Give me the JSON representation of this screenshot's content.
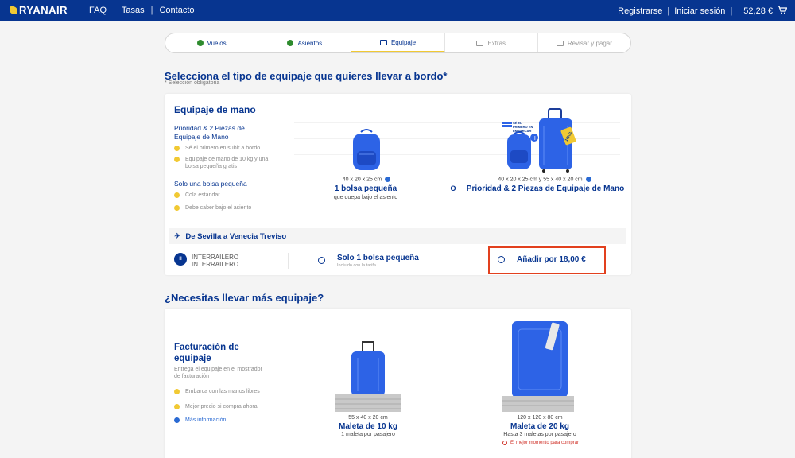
{
  "brand": {
    "logo_text": "RYANAIR",
    "accent": "#f1c933",
    "primary": "#073590",
    "highlight": "#e2401e"
  },
  "header": {
    "nav": [
      "FAQ",
      "Tasas",
      "Contacto"
    ],
    "register": "Registrarse",
    "login": "Iniciar sesión",
    "price": "52,28 €",
    "cart_icon": "cart-icon"
  },
  "steps": [
    {
      "label": "Vuelos",
      "state": "done"
    },
    {
      "label": "Asientos",
      "state": "done"
    },
    {
      "label": "Equipaje",
      "state": "active"
    },
    {
      "label": "Extras",
      "state": "todo"
    },
    {
      "label": "Revisar y pagar",
      "state": "todo"
    }
  ],
  "section1": {
    "title": "Selecciona el tipo de equipaje que quieres llevar a bordo*",
    "required_note": "* Selección obligatoria"
  },
  "hand": {
    "title": "Equipaje de mano",
    "priority_title": "Prioridad & 2 Piezas de Equipaje de Mano",
    "priority_features": [
      "Sé el primero en subir a bordo",
      "Equipaje de mano de 10 kg y una bolsa pequeña gratis"
    ],
    "small_title": "Solo una bolsa pequeña",
    "small_features": [
      "Cola estándar",
      "Debe caber bajo el asiento"
    ],
    "opt_small": {
      "dims": "40 x 20 x 25 cm",
      "name": "1 bolsa pequeña",
      "desc": "que quepa bajo el asiento"
    },
    "or": "O",
    "opt_priority": {
      "dims": "40 x 20 x 25 cm y 55 x 40 x 20 cm",
      "name": "Prioridad & 2 Piezas de Equipaje de Mano",
      "badge": "SÉ EL PRIMERO EN EMBARCAR",
      "tag": "10KG"
    }
  },
  "route": {
    "label": "De Sevilla a Venecia Treviso",
    "icon": "plane-icon"
  },
  "passenger": {
    "badge": "II",
    "line1": "INTERRAILERO",
    "line2": "INTERRAILERO"
  },
  "choice": {
    "small_label": "Solo 1 bolsa pequeña",
    "small_sub": "Incluido con la tarifa",
    "add_label": "Añadir por 18,00 €"
  },
  "section2": {
    "title": "¿Necesitas llevar más equipaje?"
  },
  "checked": {
    "title": "Facturación de equipaje",
    "desc": "Entrega el equipaje en el mostrador de facturación",
    "features": [
      "Embarca con las manos libres",
      "Mejor precio si compra ahora"
    ],
    "more_info": "Más información",
    "bag10": {
      "dims": "55 x 40 x 20 cm",
      "name": "Maleta de 10 kg",
      "desc": "1 maleta por pasajero"
    },
    "bag20": {
      "dims": "120 x 120 x 80 cm",
      "name": "Maleta de 20 kg",
      "desc": "Hasta 3 maletas por pasajero",
      "warning": "El mejor momento para comprar"
    }
  }
}
